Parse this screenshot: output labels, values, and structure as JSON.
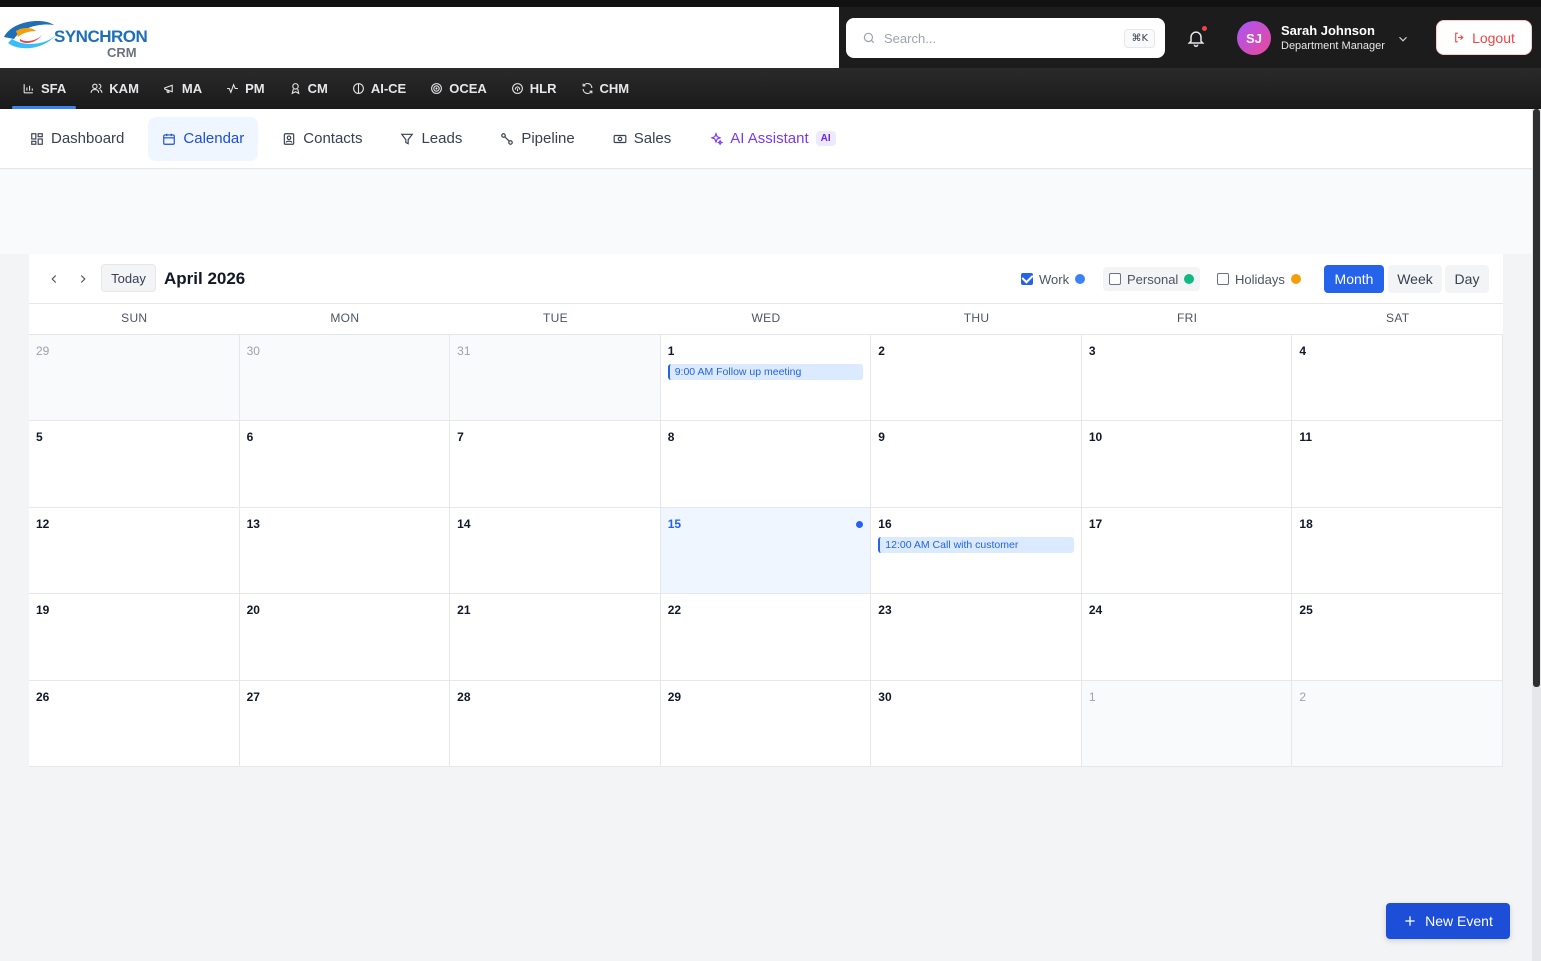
{
  "brand": {
    "logo_main": "SYNCHRON",
    "logo_sub": "CRM"
  },
  "search": {
    "placeholder": "Search...",
    "shortcut": "⌘K"
  },
  "user": {
    "initials": "SJ",
    "name": "Sarah Johnson",
    "role": "Department Manager"
  },
  "logout_label": "Logout",
  "modules": [
    {
      "label": "SFA",
      "icon": "bar-chart-icon"
    },
    {
      "label": "KAM",
      "icon": "users-icon"
    },
    {
      "label": "MA",
      "icon": "megaphone-icon"
    },
    {
      "label": "PM",
      "icon": "activity-icon"
    },
    {
      "label": "CM",
      "icon": "award-icon"
    },
    {
      "label": "AI-CE",
      "icon": "brain-icon"
    },
    {
      "label": "OCEA",
      "icon": "target-icon"
    },
    {
      "label": "HLR",
      "icon": "fingerprint-icon"
    },
    {
      "label": "CHM",
      "icon": "refresh-icon"
    }
  ],
  "tabs": [
    {
      "label": "Dashboard",
      "icon": "grid-icon"
    },
    {
      "label": "Calendar",
      "icon": "calendar-icon"
    },
    {
      "label": "Contacts",
      "icon": "contact-icon"
    },
    {
      "label": "Leads",
      "icon": "filter-icon"
    },
    {
      "label": "Pipeline",
      "icon": "pipeline-icon"
    },
    {
      "label": "Sales",
      "icon": "money-icon"
    },
    {
      "label": "AI Assistant",
      "icon": "sparkles-icon",
      "badge": "AI"
    }
  ],
  "calendar": {
    "today_label": "Today",
    "title": "April 2026",
    "filters": [
      {
        "label": "Work",
        "checked": true,
        "color": "#3b82f6"
      },
      {
        "label": "Personal",
        "checked": false,
        "color": "#10b981"
      },
      {
        "label": "Holidays",
        "checked": false,
        "color": "#f59e0b"
      }
    ],
    "views": [
      "Month",
      "Week",
      "Day"
    ],
    "active_view": "Month",
    "weekdays": [
      "SUN",
      "MON",
      "TUE",
      "WED",
      "THU",
      "FRI",
      "SAT"
    ],
    "days": [
      {
        "n": "29",
        "other": true
      },
      {
        "n": "30",
        "other": true
      },
      {
        "n": "31",
        "other": true
      },
      {
        "n": "1",
        "events": [
          "9:00 AM Follow up meeting"
        ]
      },
      {
        "n": "2"
      },
      {
        "n": "3"
      },
      {
        "n": "4"
      },
      {
        "n": "5"
      },
      {
        "n": "6"
      },
      {
        "n": "7"
      },
      {
        "n": "8"
      },
      {
        "n": "9"
      },
      {
        "n": "10"
      },
      {
        "n": "11"
      },
      {
        "n": "12"
      },
      {
        "n": "13"
      },
      {
        "n": "14"
      },
      {
        "n": "15",
        "today": true
      },
      {
        "n": "16",
        "events": [
          "12:00 AM Call with customer"
        ]
      },
      {
        "n": "17"
      },
      {
        "n": "18"
      },
      {
        "n": "19"
      },
      {
        "n": "20"
      },
      {
        "n": "21"
      },
      {
        "n": "22"
      },
      {
        "n": "23"
      },
      {
        "n": "24"
      },
      {
        "n": "25"
      },
      {
        "n": "26"
      },
      {
        "n": "27"
      },
      {
        "n": "28"
      },
      {
        "n": "29"
      },
      {
        "n": "30"
      },
      {
        "n": "1",
        "other": true
      },
      {
        "n": "2",
        "other": true
      }
    ]
  },
  "new_event_label": "New Event"
}
